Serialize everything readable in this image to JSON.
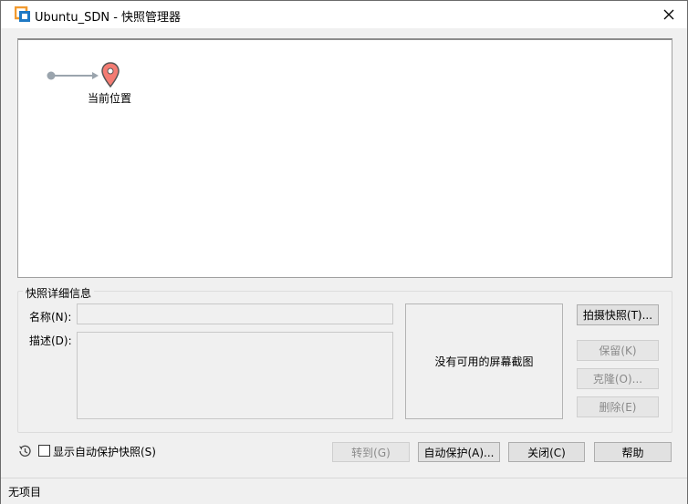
{
  "window": {
    "title": "Ubuntu_SDN - 快照管理器"
  },
  "tree": {
    "current_label": "当前位置"
  },
  "details": {
    "group_title": "快照详细信息",
    "name_label": "名称(N):",
    "name_value": "",
    "desc_label": "描述(D):",
    "desc_value": "",
    "screenshot_placeholder": "没有可用的屏幕截图"
  },
  "side_buttons": {
    "take_snapshot": "拍摄快照(T)...",
    "keep": "保留(K)",
    "clone": "克隆(O)...",
    "delete": "删除(E)"
  },
  "bottom": {
    "show_autoprotect_label": "显示自动保护快照(S)",
    "show_autoprotect_checked": false,
    "goto": "转到(G)",
    "autoprotect": "自动保护(A)...",
    "close": "关闭(C)",
    "help": "帮助"
  },
  "status": {
    "text": "无项目"
  },
  "colors": {
    "pin_fill": "#f47c73",
    "pin_stroke": "#555555",
    "tree_line": "#9aa4ad",
    "app_icon_orange": "#f29a2e",
    "app_icon_blue": "#1f79c4"
  }
}
